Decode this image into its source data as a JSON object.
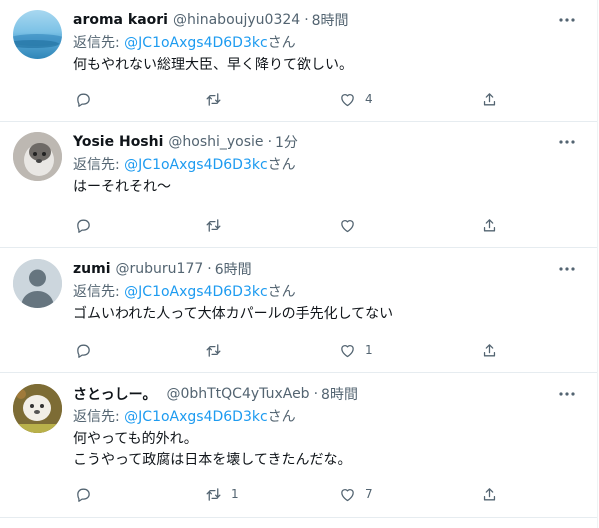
{
  "reply_prefix": "返信先: ",
  "reply_suffix": "さん",
  "tweets": [
    {
      "name": "aroma kaori",
      "handle": "@hinaboujyu0324",
      "time": "8時間",
      "reply_to": "@JC1oAxgs4D6D3kc",
      "lines": [
        "何もやれない総理大臣、早く降りて欲しい。"
      ],
      "reply_count": "",
      "retweet_count": "",
      "like_count": "4"
    },
    {
      "name": "Yosie Hoshi",
      "handle": "@hoshi_yosie",
      "time": "1分",
      "reply_to": "@JC1oAxgs4D6D3kc",
      "lines": [
        "はーそれそれ～"
      ],
      "reply_count": "",
      "retweet_count": "",
      "like_count": ""
    },
    {
      "name": "zumi",
      "handle": "@ruburu177",
      "time": "6時間",
      "reply_to": "@JC1oAxgs4D6D3kc",
      "lines": [
        "ゴムいわれた人って大体カパールの手先化してない"
      ],
      "reply_count": "",
      "retweet_count": "",
      "like_count": "1"
    },
    {
      "name": "さとっしー。",
      "handle": "@0bhTtQC4yTuxAeb",
      "time": "8時間",
      "reply_to": "@JC1oAxgs4D6D3kc",
      "lines": [
        "何やっても的外れ。",
        "こうやって政腐は日本を壊してきたんだな。"
      ],
      "reply_count": "",
      "retweet_count": "1",
      "like_count": "7"
    }
  ],
  "icons": {
    "more": "more-icon",
    "reply": "reply-icon",
    "retweet": "retweet-icon",
    "like": "like-icon",
    "share": "share-icon"
  }
}
